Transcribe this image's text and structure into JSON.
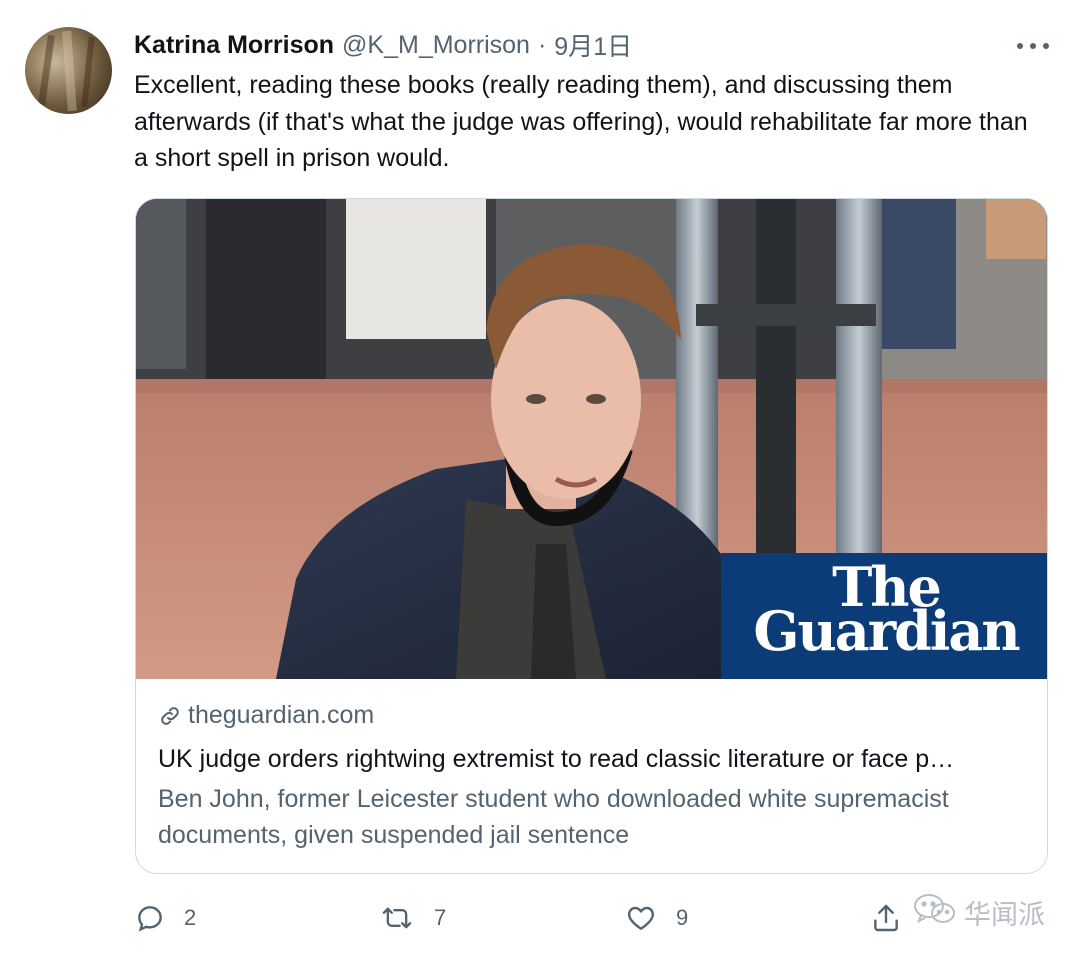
{
  "tweet": {
    "display_name": "Katrina Morrison",
    "handle": "@K_M_Morrison",
    "separator": "·",
    "date": "9月1日",
    "text": "Excellent, reading these books (really reading them), and discussing them afterwards (if that's what the judge was offering), would rehabilitate far more than a short spell in prison would."
  },
  "card": {
    "image_logo_line1": "The",
    "image_logo_line2": "Guardian",
    "domain": "theguardian.com",
    "title": "UK judge orders rightwing extremist to read classic literature or face p…",
    "description": "Ben John, former Leicester student who downloaded white supremacist documents, given suspended jail sentence"
  },
  "actions": {
    "reply_count": "2",
    "retweet_count": "7",
    "like_count": "9"
  },
  "watermark": {
    "text": "华闻派"
  },
  "icons": {
    "avatar": "profile-photo",
    "more": "more-horizontal-icon",
    "link": "link-icon",
    "reply": "reply-icon",
    "retweet": "retweet-icon",
    "like": "heart-icon",
    "share": "share-icon",
    "watermark": "wechat-icon"
  },
  "colors": {
    "primary_text": "#0f1419",
    "secondary_text": "#536471",
    "border": "#cfd9de",
    "guardian_blue": "#0c3c78"
  }
}
